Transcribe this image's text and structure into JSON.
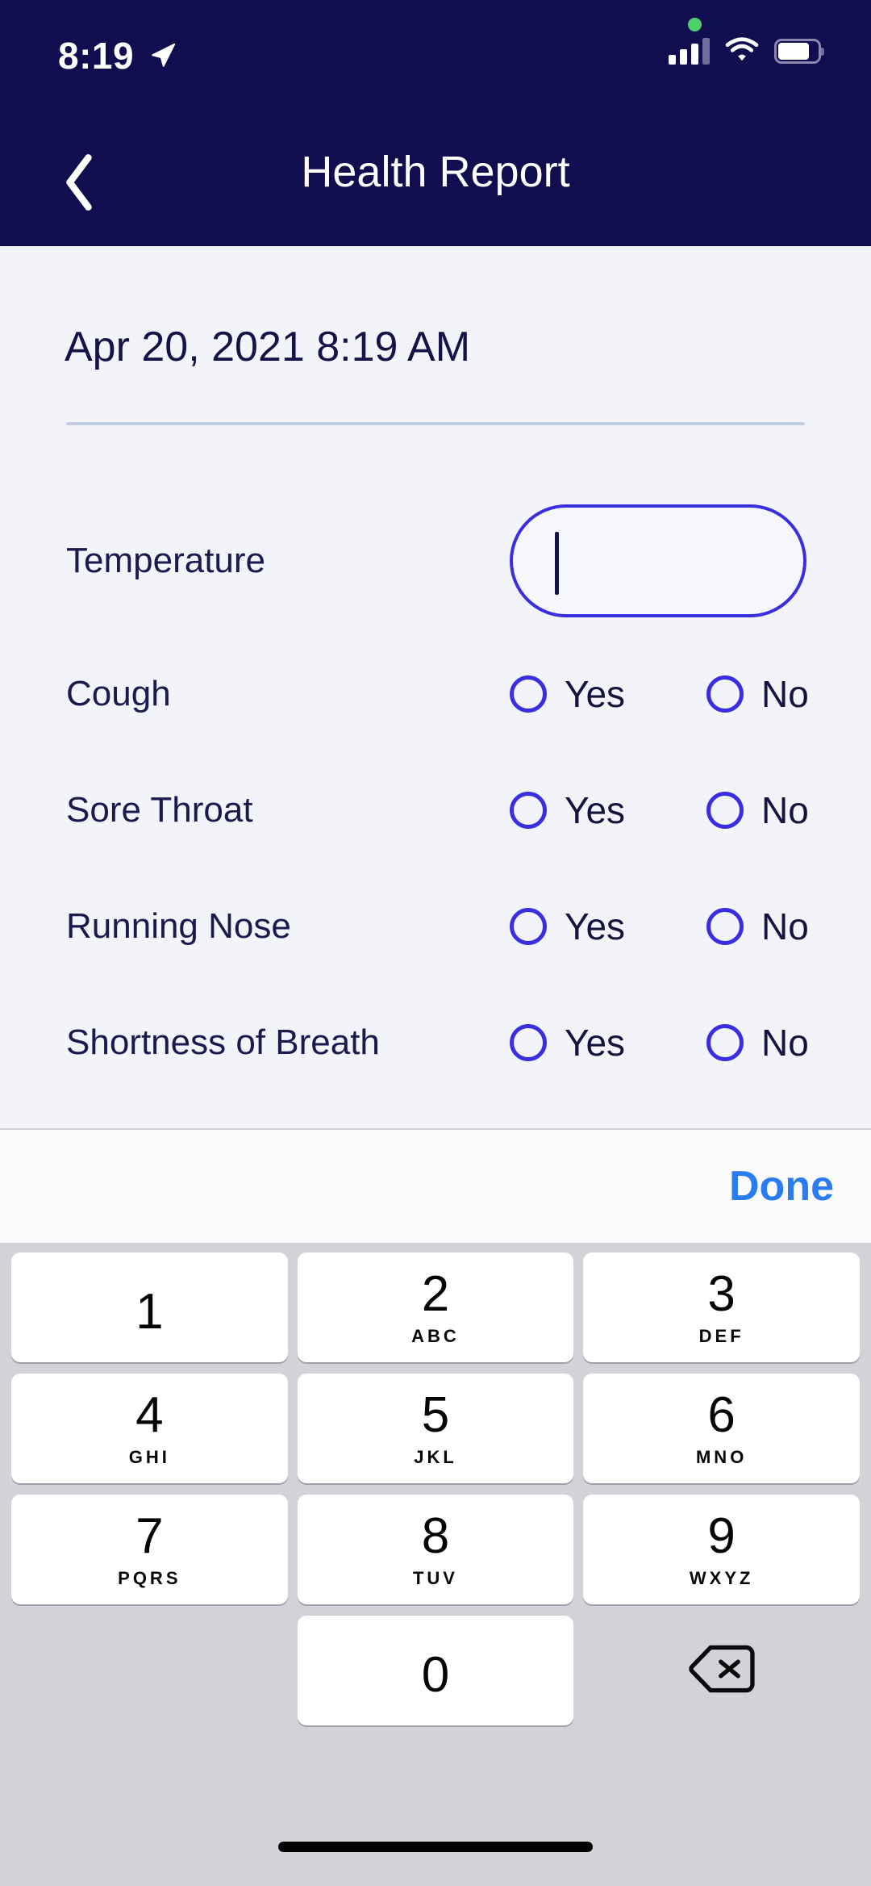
{
  "status_bar": {
    "time": "8:19",
    "location_icon": "location-arrow-icon",
    "recording_dot": "green-dot-indicator",
    "cellular_icon": "cellular-signal-icon",
    "wifi_icon": "wifi-icon",
    "battery_icon": "battery-icon"
  },
  "nav": {
    "back_icon": "chevron-left-icon",
    "title": "Health Report"
  },
  "form": {
    "date": "Apr 20, 2021 8:19 AM",
    "temperature": {
      "label": "Temperature",
      "value": "",
      "placeholder": ""
    },
    "symptoms": [
      {
        "label": "Cough",
        "yes": "Yes",
        "no": "No",
        "selected": ""
      },
      {
        "label": "Sore Throat",
        "yes": "Yes",
        "no": "No",
        "selected": ""
      },
      {
        "label": "Running Nose",
        "yes": "Yes",
        "no": "No",
        "selected": ""
      },
      {
        "label": "Shortness of Breath",
        "yes": "Yes",
        "no": "No",
        "selected": ""
      }
    ]
  },
  "keyboard": {
    "done_label": "Done",
    "keys": [
      {
        "num": "1",
        "letters": ""
      },
      {
        "num": "2",
        "letters": "ABC"
      },
      {
        "num": "3",
        "letters": "DEF"
      },
      {
        "num": "4",
        "letters": "GHI"
      },
      {
        "num": "5",
        "letters": "JKL"
      },
      {
        "num": "6",
        "letters": "MNO"
      },
      {
        "num": "7",
        "letters": "PQRS"
      },
      {
        "num": "8",
        "letters": "TUV"
      },
      {
        "num": "9",
        "letters": "WXYZ"
      },
      {
        "num": "0",
        "letters": ""
      }
    ],
    "delete_icon": "backspace-delete-icon"
  },
  "colors": {
    "navy": "#100E4E",
    "content_bg": "#F2F4F9",
    "indigo": "#3A2FE0",
    "text_navy": "#1B1A4F",
    "done_blue": "#2B7CF0",
    "keyboard_bg": "#D1D3D9",
    "key_white": "#FFFFFF",
    "green_dot": "#4CD16A"
  }
}
